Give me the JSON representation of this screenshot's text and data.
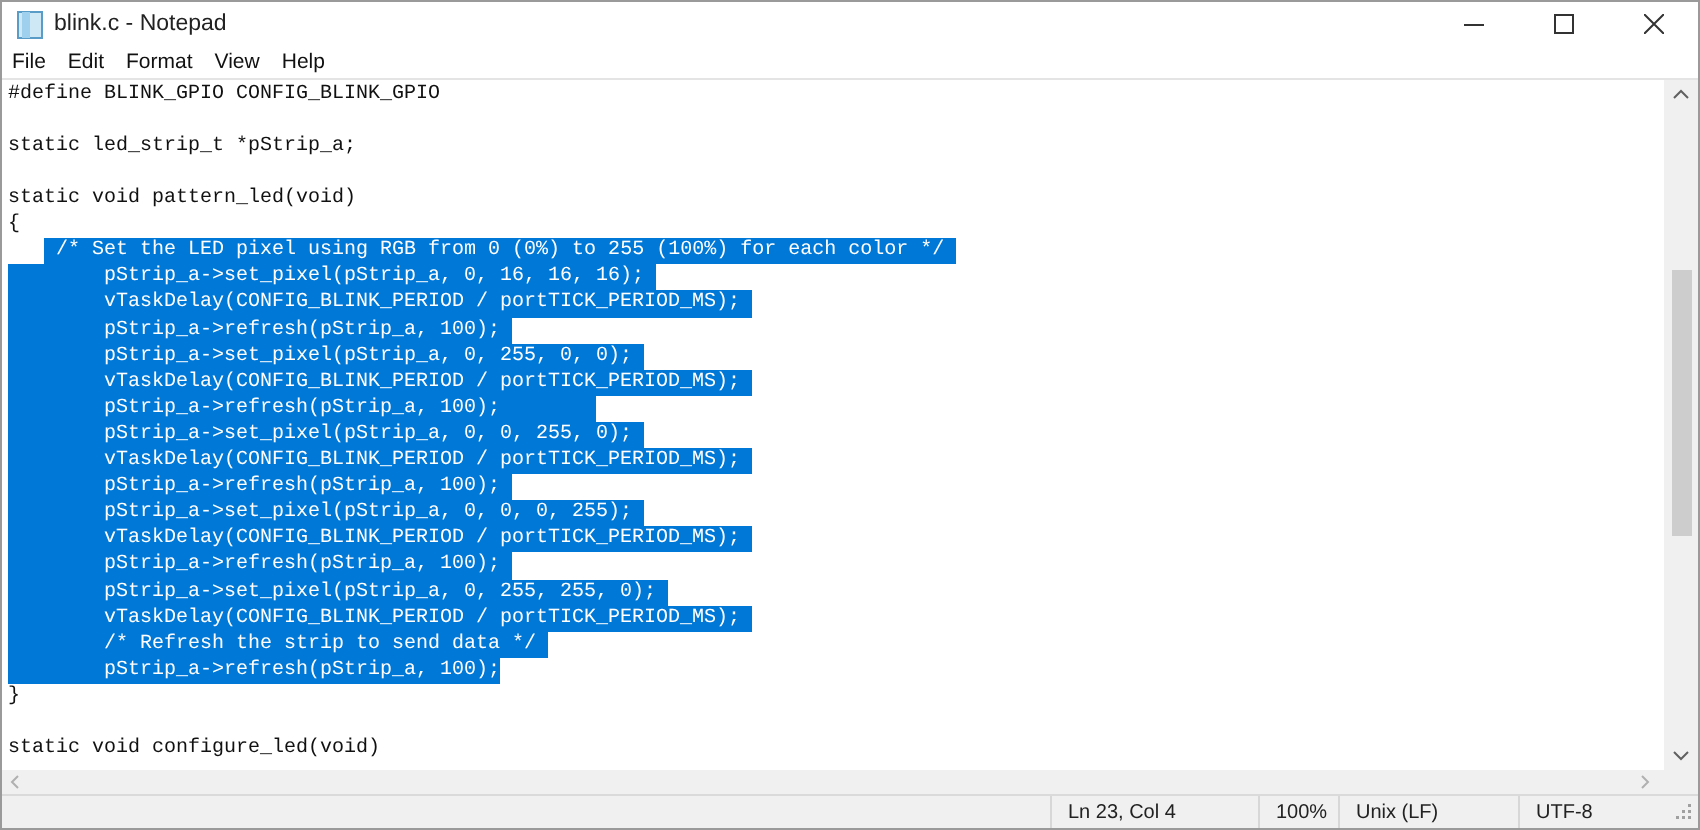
{
  "window": {
    "title": "blink.c - Notepad"
  },
  "menu": [
    "File",
    "Edit",
    "Format",
    "View",
    "Help"
  ],
  "editor": {
    "lines": [
      {
        "kind": "code",
        "text": "#define BLINK_GPIO CONFIG_BLINK_GPIO",
        "selected": false
      },
      {
        "kind": "blank"
      },
      {
        "kind": "code",
        "text": "static led_strip_t *pStrip_a;",
        "selected": false
      },
      {
        "kind": "blank"
      },
      {
        "kind": "code",
        "text": "static void pattern_led(void)",
        "selected": false
      },
      {
        "kind": "code",
        "text": "{",
        "selected": false
      },
      {
        "kind": "partial",
        "text": "    /* Set the LED pixel using RGB from 0 (0%) to 255 (100%) for each color */",
        "selected": true
      },
      {
        "kind": "code",
        "text": "        pStrip_a->set_pixel(pStrip_a, 0, 16, 16, 16);",
        "selected": true
      },
      {
        "kind": "code",
        "text": "        vTaskDelay(CONFIG_BLINK_PERIOD / portTICK_PERIOD_MS);",
        "selected": true
      },
      {
        "kind": "code",
        "text": "        pStrip_a->refresh(pStrip_a, 100);",
        "selected": true
      },
      {
        "kind": "code",
        "text": "        pStrip_a->set_pixel(pStrip_a, 0, 255, 0, 0);",
        "selected": true
      },
      {
        "kind": "code",
        "text": "        vTaskDelay(CONFIG_BLINK_PERIOD / portTICK_PERIOD_MS);",
        "selected": true
      },
      {
        "kind": "code",
        "text": "        pStrip_a->refresh(pStrip_a, 100);       ",
        "selected": true
      },
      {
        "kind": "code",
        "text": "        pStrip_a->set_pixel(pStrip_a, 0, 0, 255, 0);",
        "selected": true
      },
      {
        "kind": "code",
        "text": "        vTaskDelay(CONFIG_BLINK_PERIOD / portTICK_PERIOD_MS);",
        "selected": true
      },
      {
        "kind": "code",
        "text": "        pStrip_a->refresh(pStrip_a, 100);",
        "selected": true
      },
      {
        "kind": "code",
        "text": "        pStrip_a->set_pixel(pStrip_a, 0, 0, 0, 255);",
        "selected": true
      },
      {
        "kind": "code",
        "text": "        vTaskDelay(CONFIG_BLINK_PERIOD / portTICK_PERIOD_MS);",
        "selected": true
      },
      {
        "kind": "code",
        "text": "        pStrip_a->refresh(pStrip_a, 100);",
        "selected": true
      },
      {
        "kind": "code",
        "text": "        pStrip_a->set_pixel(pStrip_a, 0, 255, 255, 0);",
        "selected": true
      },
      {
        "kind": "code",
        "text": "        vTaskDelay(CONFIG_BLINK_PERIOD / portTICK_PERIOD_MS);",
        "selected": true
      },
      {
        "kind": "code",
        "text": "        /* Refresh the strip to send data */",
        "selected": true
      },
      {
        "kind": "code",
        "text": "        pStrip_a->refresh(pStrip_a, 100);",
        "selected": true
      },
      {
        "kind": "code",
        "text": "}",
        "selected": false
      },
      {
        "kind": "blank"
      },
      {
        "kind": "code",
        "text": "static void configure_led(void)",
        "selected": false
      }
    ]
  },
  "status_bar": [
    "Ln 23, Col 4",
    "100%",
    "Unix (LF)",
    "UTF-8"
  ]
}
